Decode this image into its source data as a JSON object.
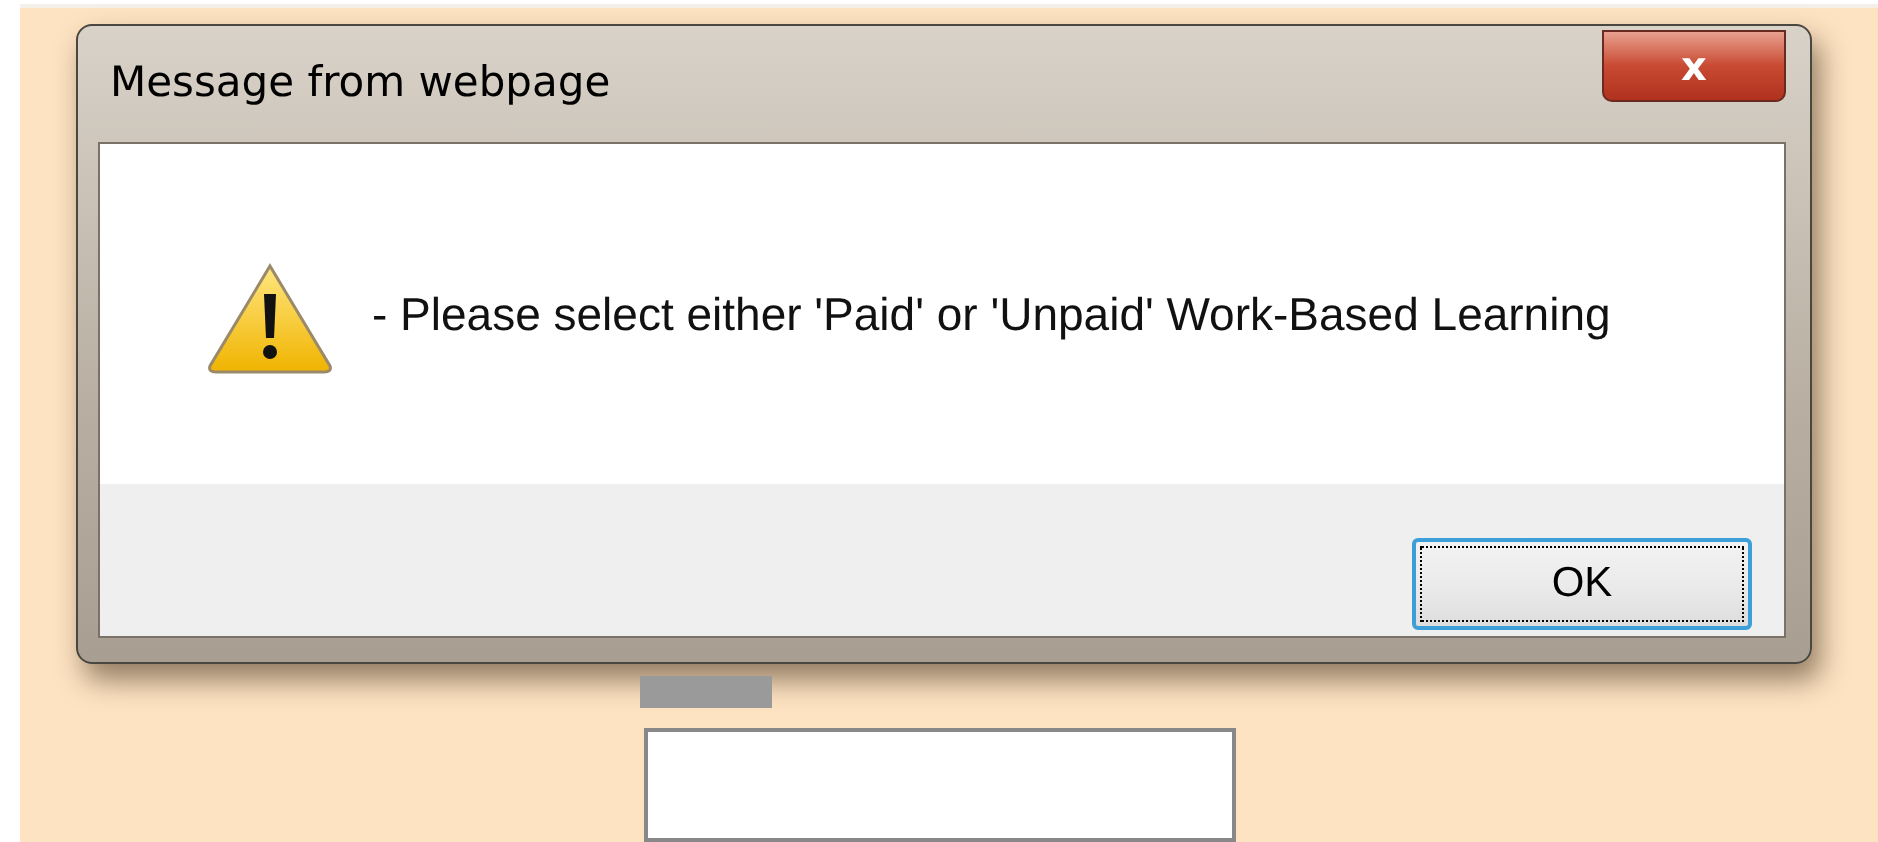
{
  "dialog": {
    "title": "Message from webpage",
    "close_label": "x",
    "message": "- Please select either 'Paid' or 'Unpaid' Work-Based Learning",
    "buttons": [
      {
        "label": "OK",
        "focused": true
      }
    ]
  }
}
